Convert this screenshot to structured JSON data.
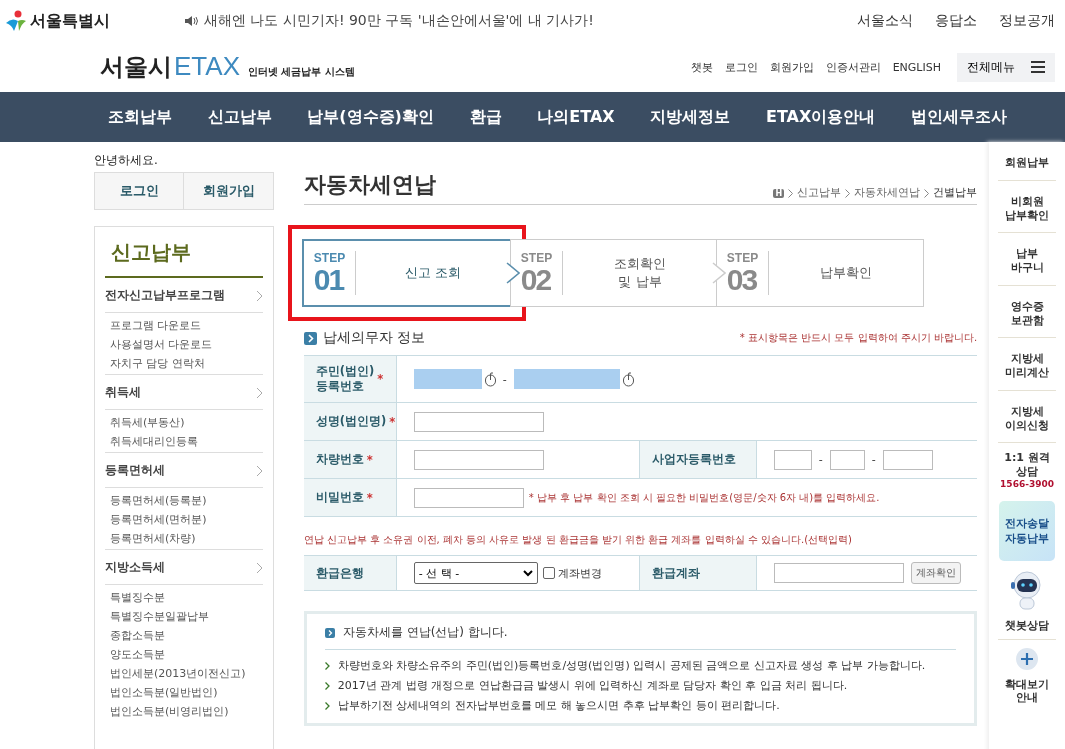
{
  "top_bar": {
    "logo": "서울특별시",
    "notice": "새해엔 나도 시민기자! 90만 구독 '내손안에서울'에 내 기사가!",
    "links": [
      "서울소식",
      "응답소",
      "정보공개"
    ]
  },
  "header": {
    "logo_main": "서울시",
    "logo_brand": "ETAX",
    "logo_sub": "인터넷 세금납부 시스템",
    "links": [
      "챗봇",
      "로그인",
      "회원가입",
      "인증서관리",
      "ENGLISH"
    ],
    "menu_button": "전체메뉴"
  },
  "nav": [
    "조회납부",
    "신고납부",
    "납부(영수증)확인",
    "환급",
    "나의ETAX",
    "지방세정보",
    "ETAX이용안내",
    "법인세무조사"
  ],
  "sidebar": {
    "greeting": "안녕하세요.",
    "buttons": [
      "로그인",
      "회원가입"
    ],
    "title": "신고납부",
    "groups": [
      {
        "label": "전자신고납부프로그램",
        "children": [
          "프로그램 다운로드",
          "사용설명서 다운로드",
          "자치구 담당 연락처"
        ]
      },
      {
        "label": "취득세",
        "children": [
          "취득세(부동산)",
          "취득세대리인등록"
        ]
      },
      {
        "label": "등록면허세",
        "children": [
          "등록면허세(등록분)",
          "등록면허세(면허분)",
          "등록면허세(차량)"
        ]
      },
      {
        "label": "지방소득세",
        "children": [
          "특별징수분",
          "특별징수분일괄납부",
          "종합소득분",
          "양도소득분",
          "법인세분(2013년이전신고)",
          "법인소득분(일반법인)",
          "법인소득분(비영리법인)"
        ]
      }
    ]
  },
  "page": {
    "title": "자동차세연납",
    "breadcrumb": [
      "H",
      "신고납부",
      "자동차세연납",
      "건별납부"
    ]
  },
  "steps": [
    {
      "label": "STEP",
      "number": "01",
      "text": "신고 조회",
      "selected": true,
      "highlighted": true
    },
    {
      "label": "STEP",
      "number": "02",
      "text": "조회확인\n및 납부",
      "selected": false,
      "highlighted": false
    },
    {
      "label": "STEP",
      "number": "03",
      "text": "납부확인",
      "selected": false,
      "highlighted": false
    }
  ],
  "section": {
    "title": "납세의무자 정보",
    "required_note": "* 표시항목은 반드시 모두 입력하여 주시기 바랍니다."
  },
  "form": {
    "resident_label": "주민(법인)\n등록번호",
    "name_label": "성명(법인명)",
    "car_label": "차량번호",
    "business_label": "사업자등록번호",
    "password_label": "비밀번호",
    "password_hint": "* 납부 후 납부 확인 조회 시 필요한 비밀번호(영문/숫자 6자 내)를 입력하세요.",
    "required_mark": "*",
    "dash": "-"
  },
  "refund": {
    "note": "연납 신고납부 후 소유권 이전, 폐차 등의 사유로 발생 된 환급금을 받기 위한 환급 계좌를 입력하실 수 있습니다.(선택입력)",
    "bank_label": "환급은행",
    "bank_select": "- 선 택 -",
    "change_label": "계좌변경",
    "change_checked": false,
    "account_label": "환급계좌",
    "check_button": "계좌확인"
  },
  "info": {
    "title": "자동차세를 연납(선납) 합니다.",
    "items": [
      "차량번호와 차량소유주의 주민(법인)등록번호/성명(법인명) 입력시 공제된 금액으로 신고자료 생성 후 납부 가능합니다.",
      "2017년 관계 법령 개정으로 연납환급금 발생시 위에 입력하신 계좌로 담당자 확인 후 입금 처리 됩니다.",
      "납부하기전 상세내역의 전자납부번호를 메모 해 놓으시면 추후 납부확인 등이 편리합니다."
    ]
  },
  "quick_menu": [
    {
      "kind": "link",
      "text": "회원납부"
    },
    {
      "kind": "link",
      "text": "비회원\n납부확인"
    },
    {
      "kind": "link",
      "text": "납부\n바구니"
    },
    {
      "kind": "link",
      "text": "영수증\n보관함"
    },
    {
      "kind": "link",
      "text": "지방세\n미리계산"
    },
    {
      "kind": "link",
      "text": "지방세\n이의신청"
    },
    {
      "kind": "phone",
      "text": "1:1 원격\n상담",
      "phone": "1566-3900"
    },
    {
      "kind": "promo",
      "text": "전자송달\n자동납부"
    },
    {
      "kind": "chatbot",
      "text": "챗봇상담"
    },
    {
      "kind": "zoom",
      "text": "확대보기\n안내"
    }
  ]
}
